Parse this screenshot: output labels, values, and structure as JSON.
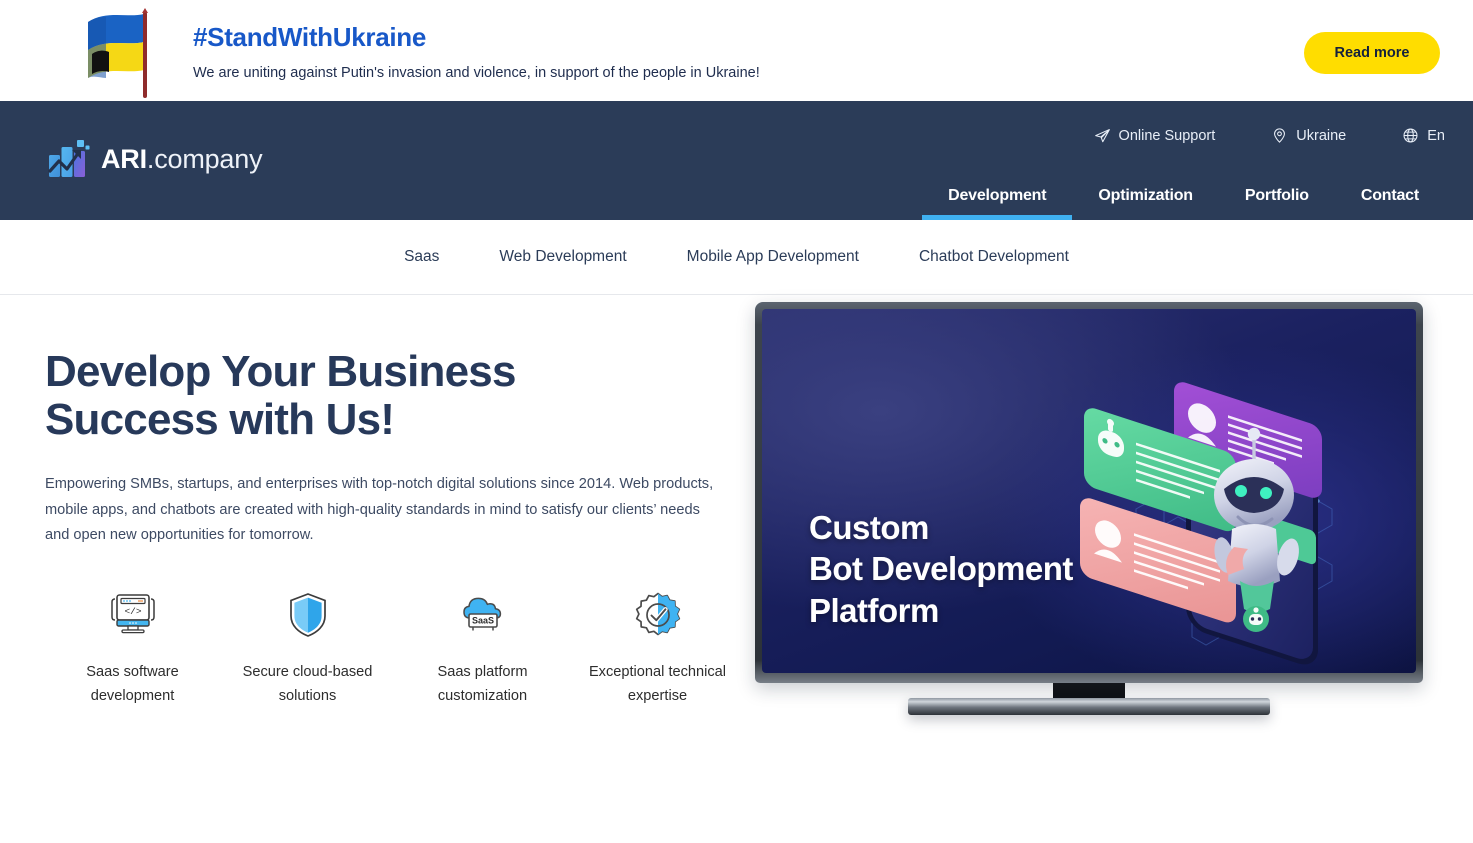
{
  "banner": {
    "flag_icon": "ukraine-flag-icon",
    "hashtag": "#StandWithUkraine",
    "message": "We are uniting against Putin's invasion and violence, in support of the people in Ukraine!",
    "cta_label": "Read more",
    "cta_color": "#FFDD00",
    "title_color": "#1858C8"
  },
  "header": {
    "background_color": "#2B3C58",
    "logo": {
      "icon": "bar-chart-growth-icon",
      "name_bold": "ARI",
      "name_light": ".company"
    },
    "utilities": [
      {
        "icon": "paper-plane-icon",
        "label": "Online Support"
      },
      {
        "icon": "location-pin-icon",
        "label": "Ukraine"
      },
      {
        "icon": "globe-icon",
        "label": "En"
      }
    ],
    "nav": [
      {
        "label": "Development",
        "active": true
      },
      {
        "label": "Optimization",
        "active": false
      },
      {
        "label": "Portfolio",
        "active": false
      },
      {
        "label": "Contact",
        "active": false
      }
    ],
    "active_indicator_color": "#3FB0F0"
  },
  "sub_nav": {
    "items": [
      {
        "label": "Saas"
      },
      {
        "label": "Web Development"
      },
      {
        "label": "Mobile App Development"
      },
      {
        "label": "Chatbot Development"
      }
    ]
  },
  "hero": {
    "title_line1": "Develop Your Business",
    "title_line2": "Success with Us!",
    "paragraph": "Empowering SMBs, startups, and enterprises with top-notch digital solutions since 2014. Web products, mobile apps, and chatbots are created with high-quality standards in mind to satisfy our clients’ needs and open new opportunities for tomorrow.",
    "features": [
      {
        "icon": "code-monitor-icon",
        "label": "Saas software development"
      },
      {
        "icon": "shield-icon",
        "label": "Secure cloud-based solutions"
      },
      {
        "icon": "cloud-saas-icon",
        "label": "Saas platform customization"
      },
      {
        "icon": "gear-check-icon",
        "label": "Exceptional technical expertise"
      }
    ],
    "tv": {
      "screen_text_line1": "Custom",
      "screen_text_line2": "Bot Development",
      "screen_text_line3": "Platform",
      "illustration": "chatbot-phone-illustration"
    }
  }
}
